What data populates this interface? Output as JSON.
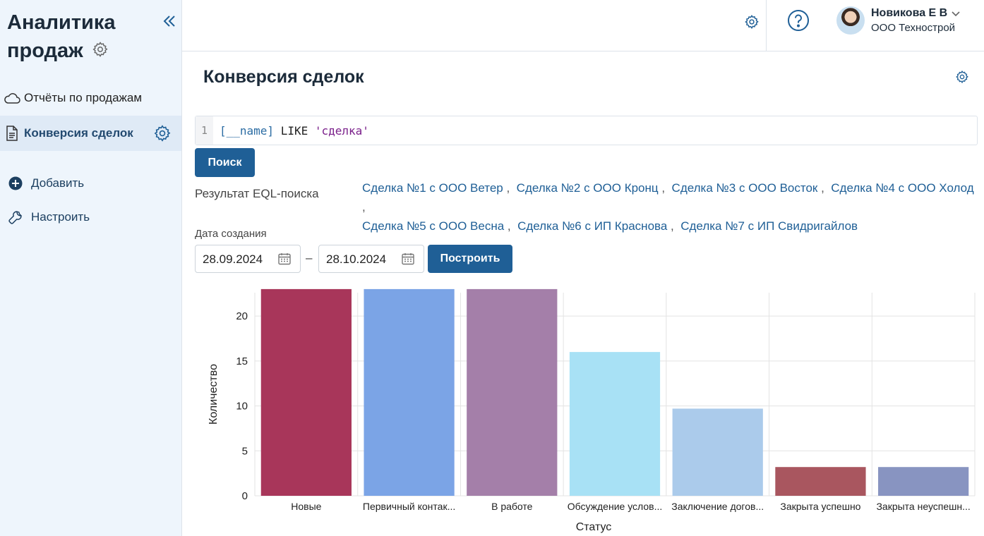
{
  "sidebar": {
    "title": "Аналитика продаж",
    "items": [
      {
        "label": "Отчёты по продажам"
      },
      {
        "label": "Конверсия сделок"
      }
    ],
    "actions": [
      {
        "label": "Добавить"
      },
      {
        "label": "Настроить"
      }
    ]
  },
  "header": {
    "user_name": "Новикова Е В",
    "user_org": "ООО Технострой"
  },
  "main": {
    "page_title": "Конверсия сделок",
    "query": {
      "line_number": "1",
      "field": "[__name]",
      "keyword": "LIKE",
      "string": "'сделка'"
    },
    "search_button": "Поиск",
    "result_label": "Результат EQL-поиска",
    "results": [
      "Сделка №1 с ООО Ветер",
      "Сделка №2 с ООО Кронц",
      "Сделка №3 с ООО Восток",
      "Сделка №4 с ООО Холод",
      "Сделка №5 с ООО Весна",
      "Сделка №6 с ИП Краснова",
      "Сделка №7 с ИП Свидригайлов"
    ],
    "date_label": "Дата создания",
    "date_from": "28.09.2024",
    "date_to": "28.10.2024",
    "date_dash": "–",
    "build_button": "Построить"
  },
  "chart_data": {
    "type": "bar",
    "categories": [
      "Новые",
      "Первичный контак...",
      "В работе",
      "Обсуждение услов...",
      "Заключение догов...",
      "Закрыта успешно",
      "Закрыта неуспешн..."
    ],
    "values": [
      23,
      23,
      23,
      16,
      9.7,
      3.2,
      3.2
    ],
    "colors": [
      "#a8365a",
      "#7ba4e6",
      "#a47fa9",
      "#a8e1f5",
      "#abcbeb",
      "#a9565f",
      "#8894c1"
    ],
    "xlabel": "Статус",
    "ylabel": "Количество",
    "yticks": [
      0,
      5,
      10,
      15,
      20
    ],
    "ylim": [
      0,
      22.6
    ],
    "grid": true
  }
}
